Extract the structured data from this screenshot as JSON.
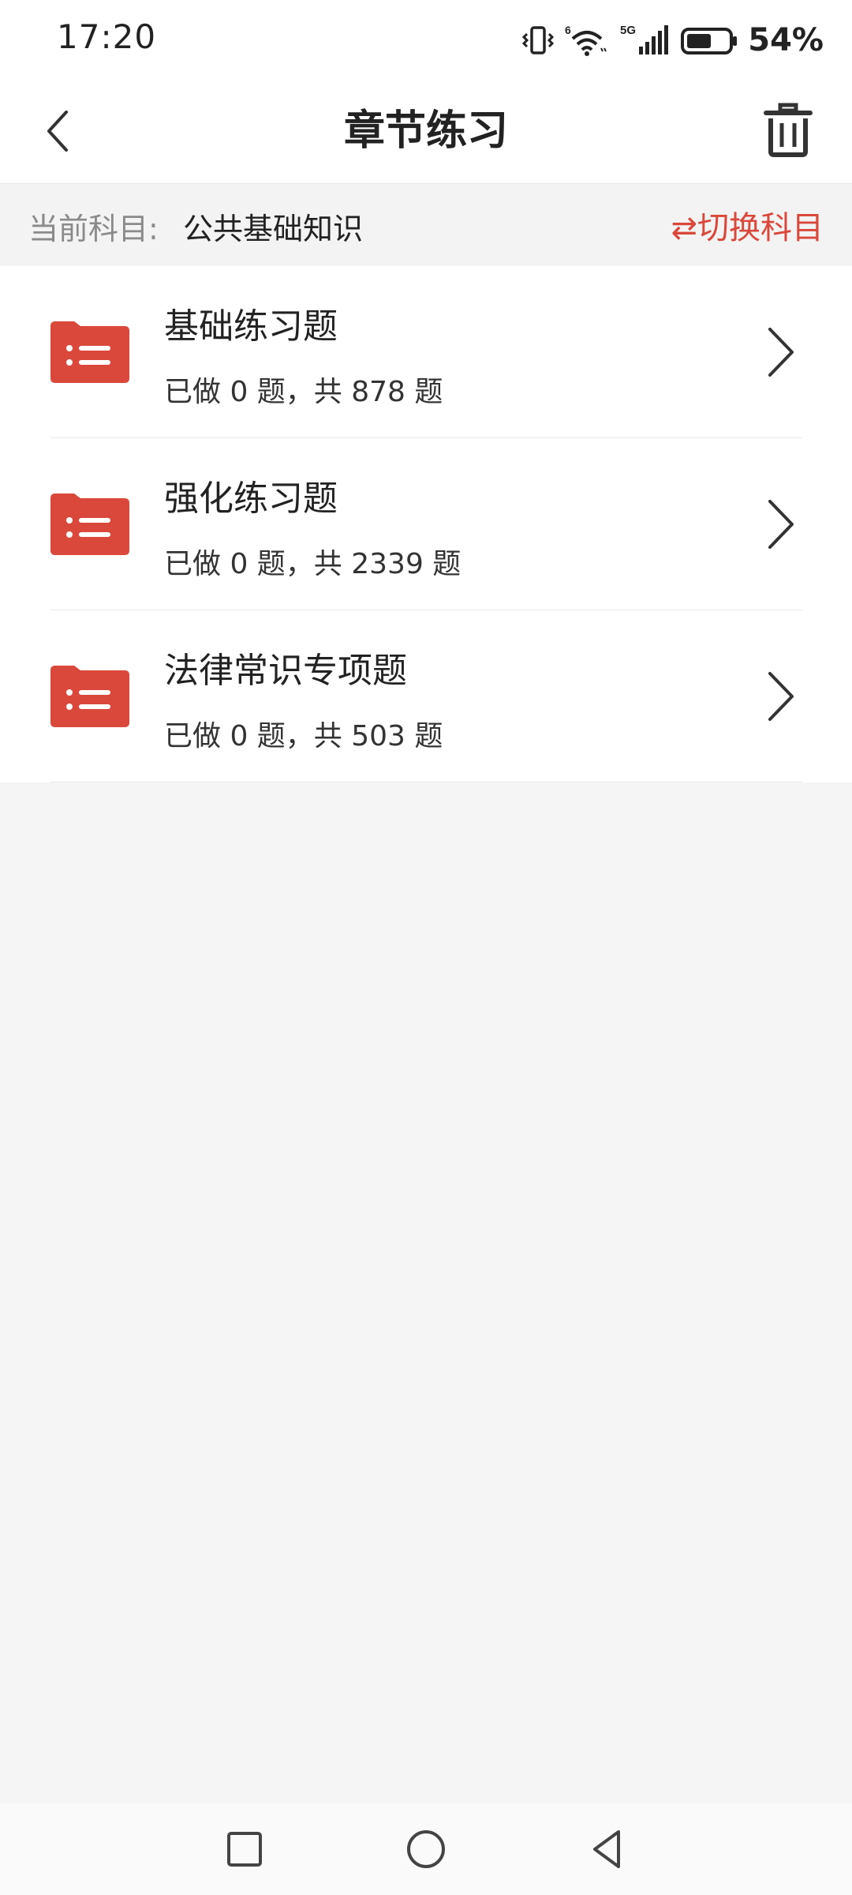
{
  "status_bar": {
    "time": "17:20",
    "battery_text": "54%",
    "network_label": "5G",
    "wifi_badge": "6"
  },
  "header": {
    "title": "章节练习"
  },
  "subject_bar": {
    "label": "当前科目:",
    "value": "公共基础知识",
    "switch_label": "⇄切换科目"
  },
  "list": {
    "items": [
      {
        "title": "基础练习题",
        "subtitle": "已做 0 题，共 878 题"
      },
      {
        "title": "强化练习题",
        "subtitle": "已做 0 题，共 2339 题"
      },
      {
        "title": "法律常识专项题",
        "subtitle": "已做 0 题，共 503 题"
      }
    ]
  },
  "colors": {
    "accent": "#d9483b",
    "background": "#f5f5f5"
  }
}
